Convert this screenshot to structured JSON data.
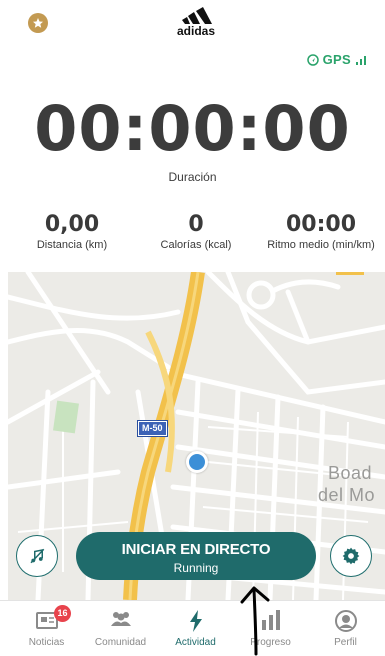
{
  "header": {
    "brand": "adidas",
    "gps_label": "GPS"
  },
  "timer": {
    "value": "00:00:00",
    "label": "Duración"
  },
  "stats": [
    {
      "value": "0,00",
      "label": "Distancia (km)"
    },
    {
      "value": "0",
      "label": "Calorías (kcal)"
    },
    {
      "value": "00:00",
      "label": "Ritmo medio (min/km)"
    }
  ],
  "map": {
    "road_label": "M-50",
    "place_line1": "Boad",
    "place_line2": "del Mo"
  },
  "controls": {
    "start_title": "INICIAR EN DIRECTO",
    "start_subtitle": "Running"
  },
  "nav": {
    "tabs": [
      {
        "label": "Noticias",
        "badge": "16"
      },
      {
        "label": "Comunidad"
      },
      {
        "label": "Actividad",
        "active": true
      },
      {
        "label": "Progreso"
      },
      {
        "label": "Perfil"
      }
    ]
  },
  "colors": {
    "accent": "#1f6b6b",
    "gps": "#2aa36b",
    "badge": "#e8434c",
    "premium": "#c39a52"
  }
}
